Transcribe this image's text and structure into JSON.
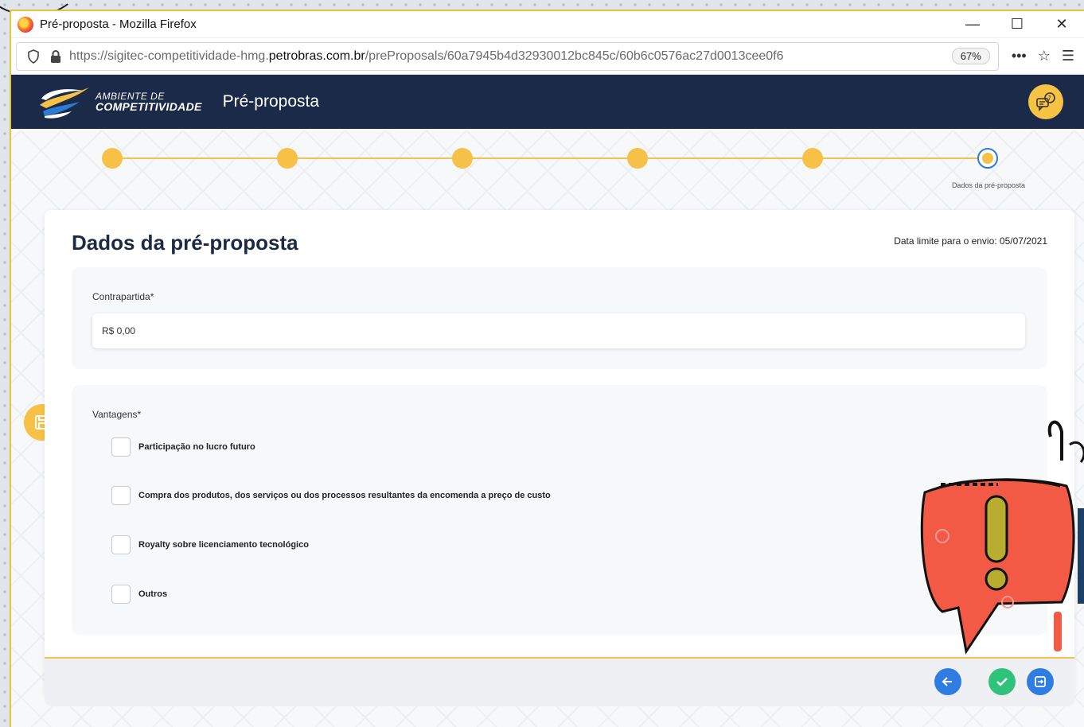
{
  "window": {
    "title": "Pré-proposta - Mozilla Firefox",
    "minimize": "—",
    "maximize": "☐",
    "close": "✕"
  },
  "browser": {
    "url_prefix": "https://sigitec-competitividade-hmg.",
    "url_domain": "petrobras.com.br",
    "url_path": "/preProposals/60a7945b4d32930012bc845c/60b6c0576ac27d0013cee0f6",
    "zoom": "67%",
    "more": "•••",
    "star": "☆",
    "menu": "☰"
  },
  "header": {
    "logo_line1": "AMBIENTE DE",
    "logo_line2": "COMPETITIVIDADE",
    "title": "Pré-proposta"
  },
  "stepper": {
    "steps_total": 6,
    "current_step": 6,
    "current_label": "Dados da pré-proposta"
  },
  "form": {
    "title": "Dados da pré-proposta",
    "deadline": "Data limite para o envio: 05/07/2021",
    "contrapartida_label": "Contrapartida*",
    "contrapartida_value": "R$ 0,00",
    "vantagens_label": "Vantagens*",
    "options": [
      "Participação no lucro futuro",
      "Compra dos produtos, dos serviços ou dos processos resultantes da encomenda a preço de custo",
      "Royalty sobre licenciamento tecnológico",
      "Outros"
    ]
  },
  "colors": {
    "header_bg": "#1b2a49",
    "accent_yellow": "#f7c046",
    "step_current_ring": "#2e7bd6",
    "back_button": "#2f7de1",
    "confirm_button": "#2fc27a",
    "submit_button": "#2f7de1",
    "alert_red": "#f25a46"
  }
}
